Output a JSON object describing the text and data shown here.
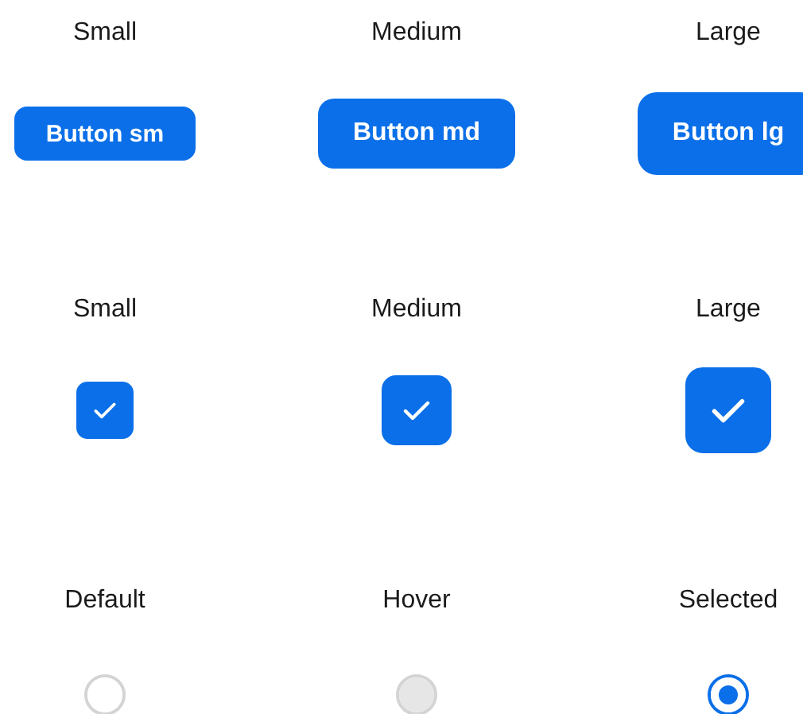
{
  "sections": [
    {
      "kind": "button",
      "items": [
        {
          "label": "Small",
          "text": "Button sm"
        },
        {
          "label": "Medium",
          "text": "Button md"
        },
        {
          "label": "Large",
          "text": "Button lg"
        }
      ]
    },
    {
      "kind": "checkbox",
      "items": [
        {
          "label": "Small",
          "checked": true
        },
        {
          "label": "Medium",
          "checked": true
        },
        {
          "label": "Large",
          "checked": true
        }
      ]
    },
    {
      "kind": "radio",
      "items": [
        {
          "label": "Default",
          "hovered": false,
          "selected": false
        },
        {
          "label": "Hover",
          "hovered": true,
          "selected": false
        },
        {
          "label": "Selected",
          "hovered": false,
          "selected": true
        }
      ]
    }
  ]
}
